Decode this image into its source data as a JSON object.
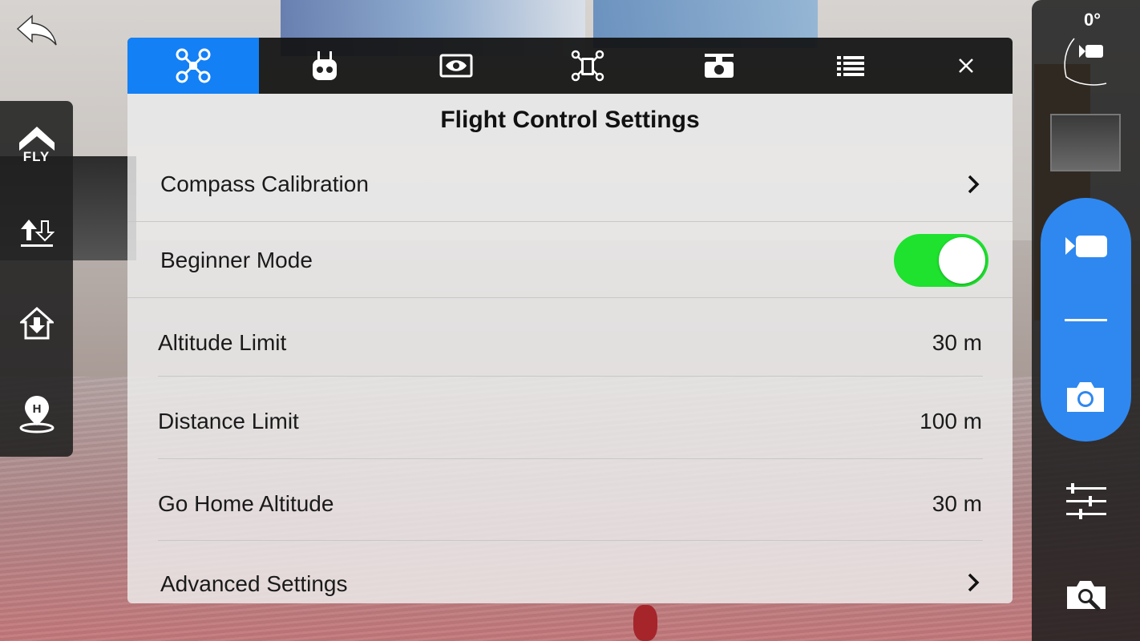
{
  "camera": {
    "gimbal_angle": "0°"
  },
  "left_rail": {
    "takeoff_label": "FLY"
  },
  "tabs": [
    {
      "icon": "aircraft-icon",
      "active": true
    },
    {
      "icon": "remote-controller-icon",
      "active": false
    },
    {
      "icon": "vision-eye-icon",
      "active": false
    },
    {
      "icon": "aircraft-battery-icon",
      "active": false
    },
    {
      "icon": "gimbal-icon",
      "active": false
    },
    {
      "icon": "general-list-icon",
      "active": false
    }
  ],
  "settings": {
    "title": "Flight Control Settings",
    "compass_calibration": "Compass Calibration",
    "beginner_mode": {
      "label": "Beginner Mode",
      "enabled": true
    },
    "altitude_limit": {
      "label": "Altitude Limit",
      "value": "30 m"
    },
    "distance_limit": {
      "label": "Distance Limit",
      "value": "100 m"
    },
    "go_home_altitude": {
      "label": "Go Home Altitude",
      "value": "30 m"
    },
    "advanced_settings": "Advanced Settings"
  },
  "colors": {
    "accent_blue": "#1380f5",
    "toggle_on": "#1ee22e",
    "capture_pill": "#2e88f0"
  }
}
